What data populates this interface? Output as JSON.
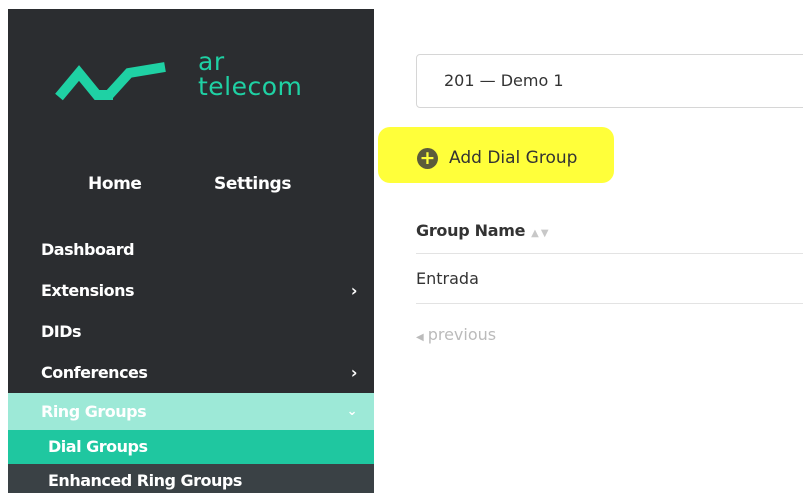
{
  "brand": {
    "line1": "ar",
    "line2": "telecom",
    "accent": "#1fd1a4"
  },
  "top_nav": {
    "home": "Home",
    "settings": "Settings"
  },
  "menu": {
    "dashboard": "Dashboard",
    "extensions": "Extensions",
    "dids": "DIDs",
    "conferences": "Conferences",
    "ring_groups": "Ring Groups",
    "chevron_right": "›",
    "chevron_down": "⌄",
    "sub": {
      "dial_groups": "Dial Groups",
      "enhanced_ring_groups": "Enhanced Ring Groups"
    }
  },
  "extension_select": {
    "value": "201  —  Demo 1"
  },
  "add_button": {
    "label": "Add Dial Group",
    "icon": "plus-circle-icon"
  },
  "table": {
    "headers": {
      "group_name": "Group Name"
    },
    "rows": [
      {
        "group_name": "Entrada"
      }
    ]
  },
  "pager": {
    "previous": "previous"
  },
  "colors": {
    "sidebar_bg": "#2b2d30",
    "expanded_bg": "#9de9d7",
    "active_bg": "#1fc7a0",
    "highlight": "#ffff3a"
  }
}
